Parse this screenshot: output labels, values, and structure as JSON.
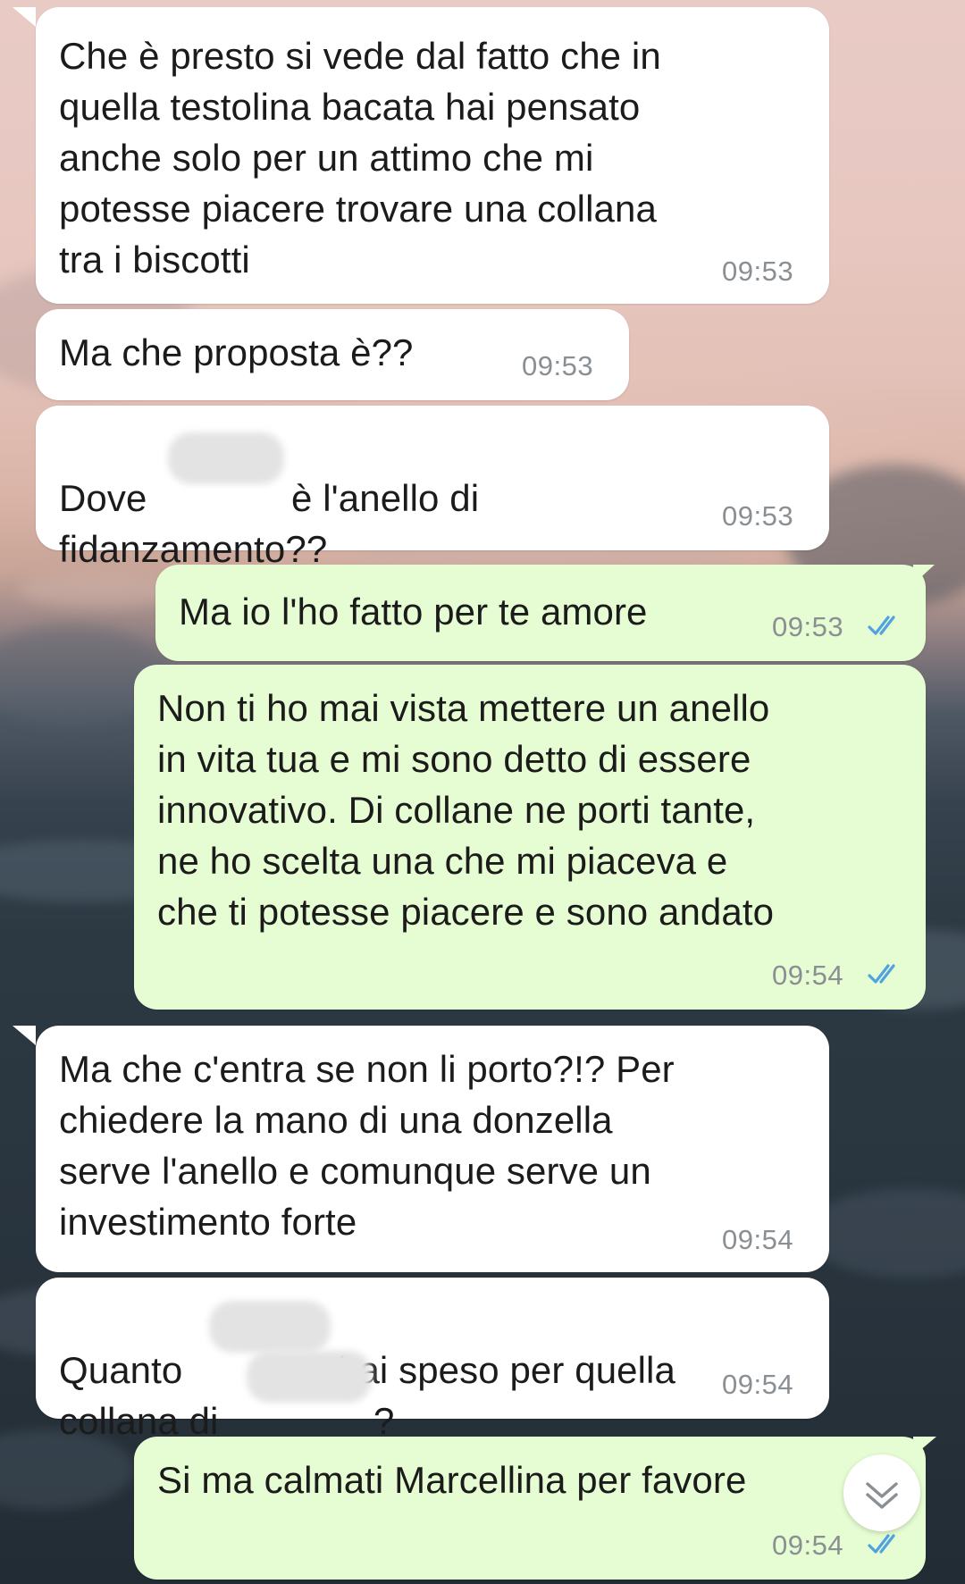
{
  "colors": {
    "incoming_bubble": "#ffffff",
    "outgoing_bubble": "#e6fcd2",
    "read_ticks": "#4fa3e0",
    "timestamp": "#8a8f94"
  },
  "messages": [
    {
      "direction": "incoming",
      "text": "Che è presto si vede dal fatto che in\nquella testolina bacata hai pensato\nanche solo per un attimo che mi\npotesse piacere trovare una collana\ntra i biscotti",
      "time": "09:53"
    },
    {
      "direction": "incoming",
      "text": "Ma che proposta è??",
      "time": "09:53"
    },
    {
      "direction": "incoming",
      "text_before_redaction": "Dove",
      "text_after_redaction": "è l'anello di",
      "text_line2": "fidanzamento??",
      "time": "09:53"
    },
    {
      "direction": "outgoing",
      "text": "Ma io l'ho fatto per te amore",
      "time": "09:53",
      "status": "read"
    },
    {
      "direction": "outgoing",
      "text": "Non ti ho mai vista mettere un anello\nin vita tua e mi sono detto di essere\ninnovativo. Di collane ne porti tante,\nne ho scelta una che mi piaceva e\nche ti potesse piacere e sono andato",
      "time": "09:54",
      "status": "read"
    },
    {
      "direction": "incoming",
      "text": "Ma che c'entra se non li porto?!? Per\nchiedere la mano di una donzella\nserve l'anello e comunque serve un\ninvestimento forte",
      "time": "09:54"
    },
    {
      "direction": "incoming",
      "text_line1_before": "Quanto",
      "text_line1_after": "hai speso per quella",
      "text_line2_before": "collana di",
      "text_line2_after": "?",
      "time": "09:54"
    },
    {
      "direction": "outgoing",
      "text": "Si ma calmati Marcellina per favore",
      "time": "09:54",
      "status": "read"
    }
  ],
  "scroll_button_icon": "double-chevron-down-icon"
}
